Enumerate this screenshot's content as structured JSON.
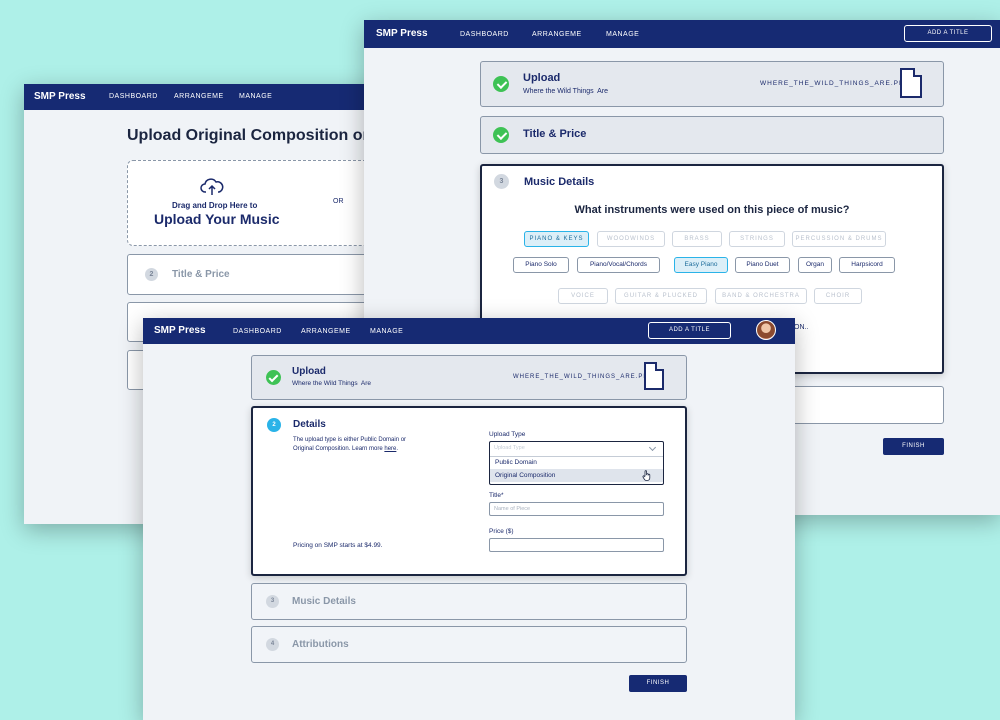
{
  "brand": "SMP Press",
  "nav": {
    "dashboard": "DASHBOARD",
    "arrangeme": "ARRANGEME",
    "manage": "MANAGE"
  },
  "add_title_label": "ADD A TITLE",
  "finish_label": "FINISH",
  "left_window": {
    "heading": "Upload Original Composition or Pu",
    "drop_small": "Drag and Drop Here to",
    "drop_big": "Upload Your Music",
    "or_label": "OR",
    "step2_num": "2",
    "step2_title": "Title & Price"
  },
  "right_window": {
    "upload_title": "Upload",
    "upload_subtitle": "Where the Wild Things  Are",
    "file_name": "WHERE_THE_WILD_THINGS_ARE.PDF",
    "title_price": "Title & Price",
    "music_step_num": "3",
    "music_title": "Music Details",
    "question": "What instruments were used on this piece of music?",
    "row1": [
      "PIANO & KEYS",
      "WOODWINDS",
      "BRASS",
      "STRINGS",
      "PERCUSSION & DRUMS"
    ],
    "row2": [
      "Piano Solo",
      "Piano/Vocal/Chords",
      "Easy Piano",
      "Piano Duet",
      "Organ",
      "Harpsicord"
    ],
    "row3": [
      "VOICE",
      "GUITAR & PLUCKED",
      "BAND & ORCHESTRA",
      "CHOIR"
    ],
    "partial_text": "ON.."
  },
  "front_window": {
    "upload_title": "Upload",
    "upload_subtitle": "Where the Wild Things  Are",
    "file_name": "WHERE_THE_WILD_THINGS_ARE.PDF",
    "details_num": "2",
    "details_title": "Details",
    "details_desc_1": "The upload type is either Public Domain or",
    "details_desc_2": "Original Composition. Learn more ",
    "details_link": "here",
    "details_desc_end": ".",
    "upload_type_label": "Upload Type",
    "upload_type_placeholder": "Upload Type",
    "dropdown_options": [
      "Public Domain",
      "Original Composition"
    ],
    "title_label": "Title*",
    "title_placeholder": "Name of Piece",
    "price_label": "Price ($)",
    "pricing_note": "Pricing on SMP starts at $4.99.",
    "music_num": "3",
    "music_title": "Music Details",
    "attr_num": "4",
    "attr_title": "Attributions"
  },
  "colors": {
    "background": "#aef0e8",
    "nav": "#162a73",
    "check": "#3ec255",
    "step_blue": "#2ab3e8"
  }
}
